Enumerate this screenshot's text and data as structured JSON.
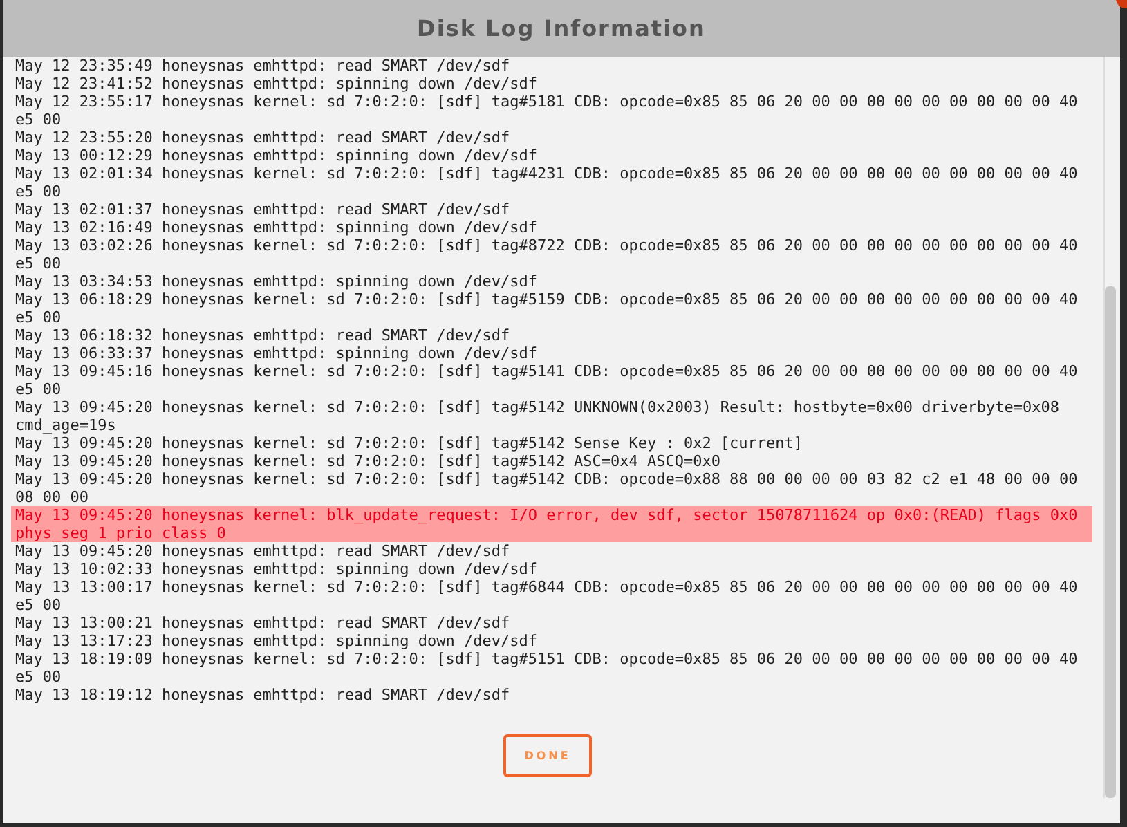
{
  "dialog": {
    "title": "Disk Log Information"
  },
  "log": [
    {
      "kind": "normal",
      "text": "May 12 23:35:49 honeysnas emhttpd: read SMART /dev/sdf"
    },
    {
      "kind": "normal",
      "text": "May 12 23:41:52 honeysnas emhttpd: spinning down /dev/sdf"
    },
    {
      "kind": "normal",
      "text": "May 12 23:55:17 honeysnas kernel: sd 7:0:2:0: [sdf] tag#5181 CDB: opcode=0x85 85 06 20 00 00 00 00 00 00 00 00 00 40 e5 00"
    },
    {
      "kind": "normal",
      "text": "May 12 23:55:20 honeysnas emhttpd: read SMART /dev/sdf"
    },
    {
      "kind": "normal",
      "text": "May 13 00:12:29 honeysnas emhttpd: spinning down /dev/sdf"
    },
    {
      "kind": "normal",
      "text": "May 13 02:01:34 honeysnas kernel: sd 7:0:2:0: [sdf] tag#4231 CDB: opcode=0x85 85 06 20 00 00 00 00 00 00 00 00 00 40 e5 00"
    },
    {
      "kind": "normal",
      "text": "May 13 02:01:37 honeysnas emhttpd: read SMART /dev/sdf"
    },
    {
      "kind": "normal",
      "text": "May 13 02:16:49 honeysnas emhttpd: spinning down /dev/sdf"
    },
    {
      "kind": "normal",
      "text": "May 13 03:02:26 honeysnas kernel: sd 7:0:2:0: [sdf] tag#8722 CDB: opcode=0x85 85 06 20 00 00 00 00 00 00 00 00 00 40 e5 00"
    },
    {
      "kind": "normal",
      "text": "May 13 03:34:53 honeysnas emhttpd: spinning down /dev/sdf"
    },
    {
      "kind": "normal",
      "text": "May 13 06:18:29 honeysnas kernel: sd 7:0:2:0: [sdf] tag#5159 CDB: opcode=0x85 85 06 20 00 00 00 00 00 00 00 00 00 40 e5 00"
    },
    {
      "kind": "normal",
      "text": "May 13 06:18:32 honeysnas emhttpd: read SMART /dev/sdf"
    },
    {
      "kind": "normal",
      "text": "May 13 06:33:37 honeysnas emhttpd: spinning down /dev/sdf"
    },
    {
      "kind": "normal",
      "text": "May 13 09:45:16 honeysnas kernel: sd 7:0:2:0: [sdf] tag#5141 CDB: opcode=0x85 85 06 20 00 00 00 00 00 00 00 00 00 40 e5 00"
    },
    {
      "kind": "normal",
      "text": "May 13 09:45:20 honeysnas kernel: sd 7:0:2:0: [sdf] tag#5142 UNKNOWN(0x2003) Result: hostbyte=0x00 driverbyte=0x08 cmd_age=19s"
    },
    {
      "kind": "normal",
      "text": "May 13 09:45:20 honeysnas kernel: sd 7:0:2:0: [sdf] tag#5142 Sense Key : 0x2 [current]"
    },
    {
      "kind": "normal",
      "text": "May 13 09:45:20 honeysnas kernel: sd 7:0:2:0: [sdf] tag#5142 ASC=0x4 ASCQ=0x0"
    },
    {
      "kind": "normal",
      "text": "May 13 09:45:20 honeysnas kernel: sd 7:0:2:0: [sdf] tag#5142 CDB: opcode=0x88 88 00 00 00 00 03 82 c2 e1 48 00 00 00 08 00 00"
    },
    {
      "kind": "error",
      "text": "May 13 09:45:20 honeysnas kernel: blk_update_request: I/O error, dev sdf, sector 15078711624 op 0x0:(READ) flags 0x0 phys_seg 1 prio class 0"
    },
    {
      "kind": "normal",
      "text": "May 13 09:45:20 honeysnas emhttpd: read SMART /dev/sdf"
    },
    {
      "kind": "normal",
      "text": "May 13 10:02:33 honeysnas emhttpd: spinning down /dev/sdf"
    },
    {
      "kind": "normal",
      "text": "May 13 13:00:17 honeysnas kernel: sd 7:0:2:0: [sdf] tag#6844 CDB: opcode=0x85 85 06 20 00 00 00 00 00 00 00 00 00 40 e5 00"
    },
    {
      "kind": "normal",
      "text": "May 13 13:00:21 honeysnas emhttpd: read SMART /dev/sdf"
    },
    {
      "kind": "normal",
      "text": "May 13 13:17:23 honeysnas emhttpd: spinning down /dev/sdf"
    },
    {
      "kind": "normal",
      "text": "May 13 18:19:09 honeysnas kernel: sd 7:0:2:0: [sdf] tag#5151 CDB: opcode=0x85 85 06 20 00 00 00 00 00 00 00 00 00 40 e5 00"
    },
    {
      "kind": "normal",
      "text": "May 13 18:19:12 honeysnas emhttpd: read SMART /dev/sdf"
    }
  ],
  "buttons": [
    {
      "label": "DONE"
    }
  ]
}
